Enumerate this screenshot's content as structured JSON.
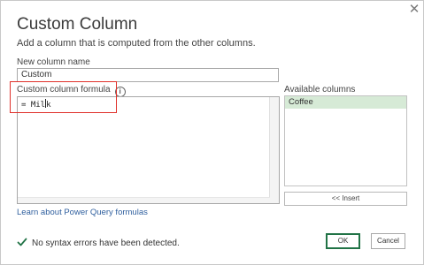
{
  "dialog": {
    "title": "Custom Column",
    "subtitle": "Add a column that is computed from the other columns.",
    "close_glyph": "✕"
  },
  "new_column": {
    "label": "New column name",
    "value": "Custom"
  },
  "formula": {
    "label": "Custom column formula",
    "info_glyph": "i",
    "value": "= Mil",
    "cursor_suffix": "k"
  },
  "available_columns": {
    "label": "Available columns",
    "items": [
      "Coffee"
    ],
    "insert_label": "<< Insert"
  },
  "learn_link": "Learn about Power Query formulas",
  "status": {
    "text": "No syntax errors have been detected.",
    "icon": "check-icon",
    "color": "#217346"
  },
  "buttons": {
    "ok": "OK",
    "cancel": "Cancel"
  },
  "colors": {
    "accent": "#217346",
    "highlight_box": "#e0302a",
    "selected_item": "#d6ead6",
    "link": "#2f5f9e"
  }
}
